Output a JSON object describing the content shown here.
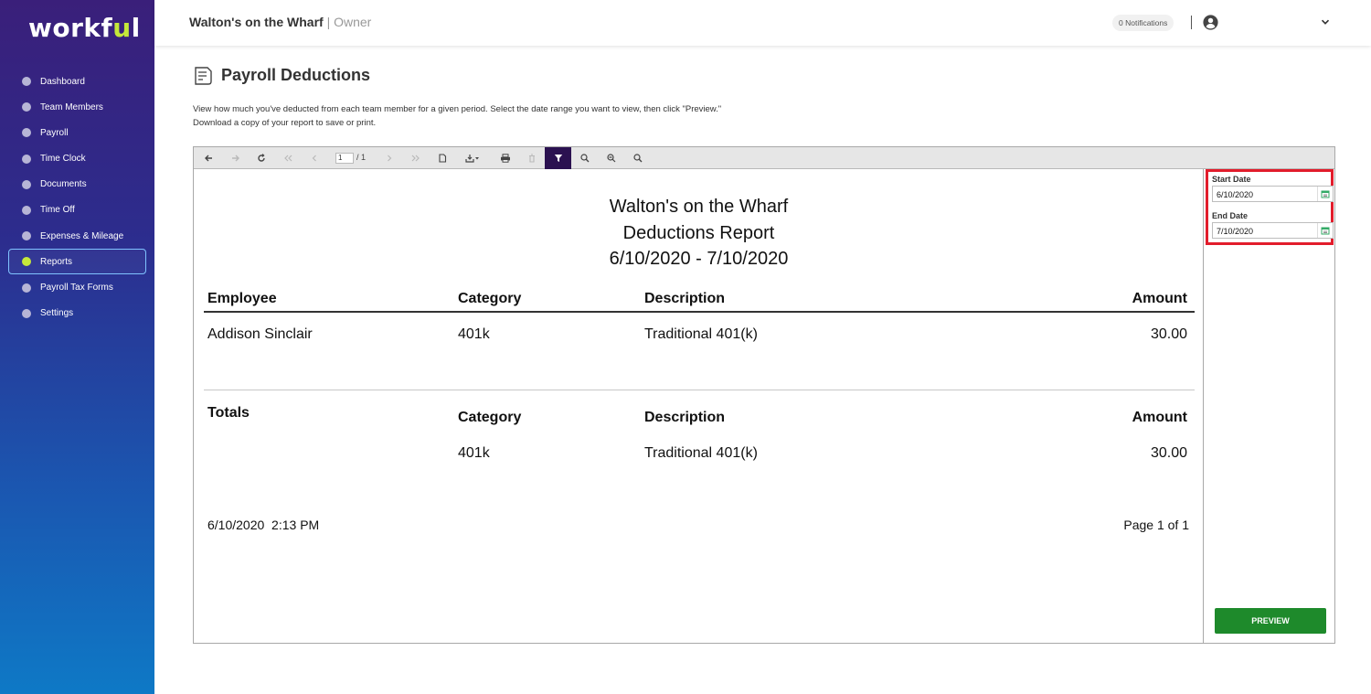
{
  "brand": {
    "name_main": "workf",
    "name_accent": "u",
    "name_tail": "l"
  },
  "sidebar": {
    "items": [
      {
        "label": "Dashboard"
      },
      {
        "label": "Team Members"
      },
      {
        "label": "Payroll"
      },
      {
        "label": "Time Clock"
      },
      {
        "label": "Documents"
      },
      {
        "label": "Time Off"
      },
      {
        "label": "Expenses & Mileage"
      },
      {
        "label": "Reports",
        "active": true
      },
      {
        "label": "Payroll Tax Forms"
      },
      {
        "label": "Settings"
      }
    ]
  },
  "header": {
    "company": "Walton's on the Wharf",
    "role_separator": " | ",
    "role": "Owner",
    "notifications": "0 Notifications",
    "user_icon": "user-circle-icon",
    "menu_icon": "chevron-down-icon"
  },
  "page": {
    "title": "Payroll Deductions",
    "icon": "document-list-icon",
    "description": "View how much you've deducted from each team member for a given period. Select the date range you want to view, then click \"Preview.\" Download a copy of your report to save or print."
  },
  "viewer": {
    "toolbar": {
      "page_input": "1",
      "page_total": "/ 1"
    },
    "report": {
      "company": "Walton's on the Wharf",
      "name": "Deductions Report",
      "range": "6/10/2020 - 7/10/2020",
      "columns": [
        "Employee",
        "Category",
        "Description",
        "Amount"
      ],
      "rows": [
        {
          "employee": "Addison Sinclair",
          "category": "401k",
          "description": "Traditional 401(k)",
          "amount": "30.00"
        }
      ],
      "totals": {
        "label": "Totals",
        "columns": [
          "Category",
          "Description",
          "Amount"
        ],
        "rows": [
          {
            "category": "401k",
            "description": "Traditional 401(k)",
            "amount": "30.00"
          }
        ]
      },
      "footer": {
        "timestamp": "6/10/2020  2:13 PM",
        "page": "Page 1 of 1"
      }
    },
    "params": {
      "start_label": "Start Date",
      "start_value": "6/10/2020",
      "end_label": "End Date",
      "end_value": "7/10/2020",
      "preview_label": "PREVIEW",
      "highlight_color": "#e21c2b",
      "preview_color": "#1e8a2b"
    }
  }
}
